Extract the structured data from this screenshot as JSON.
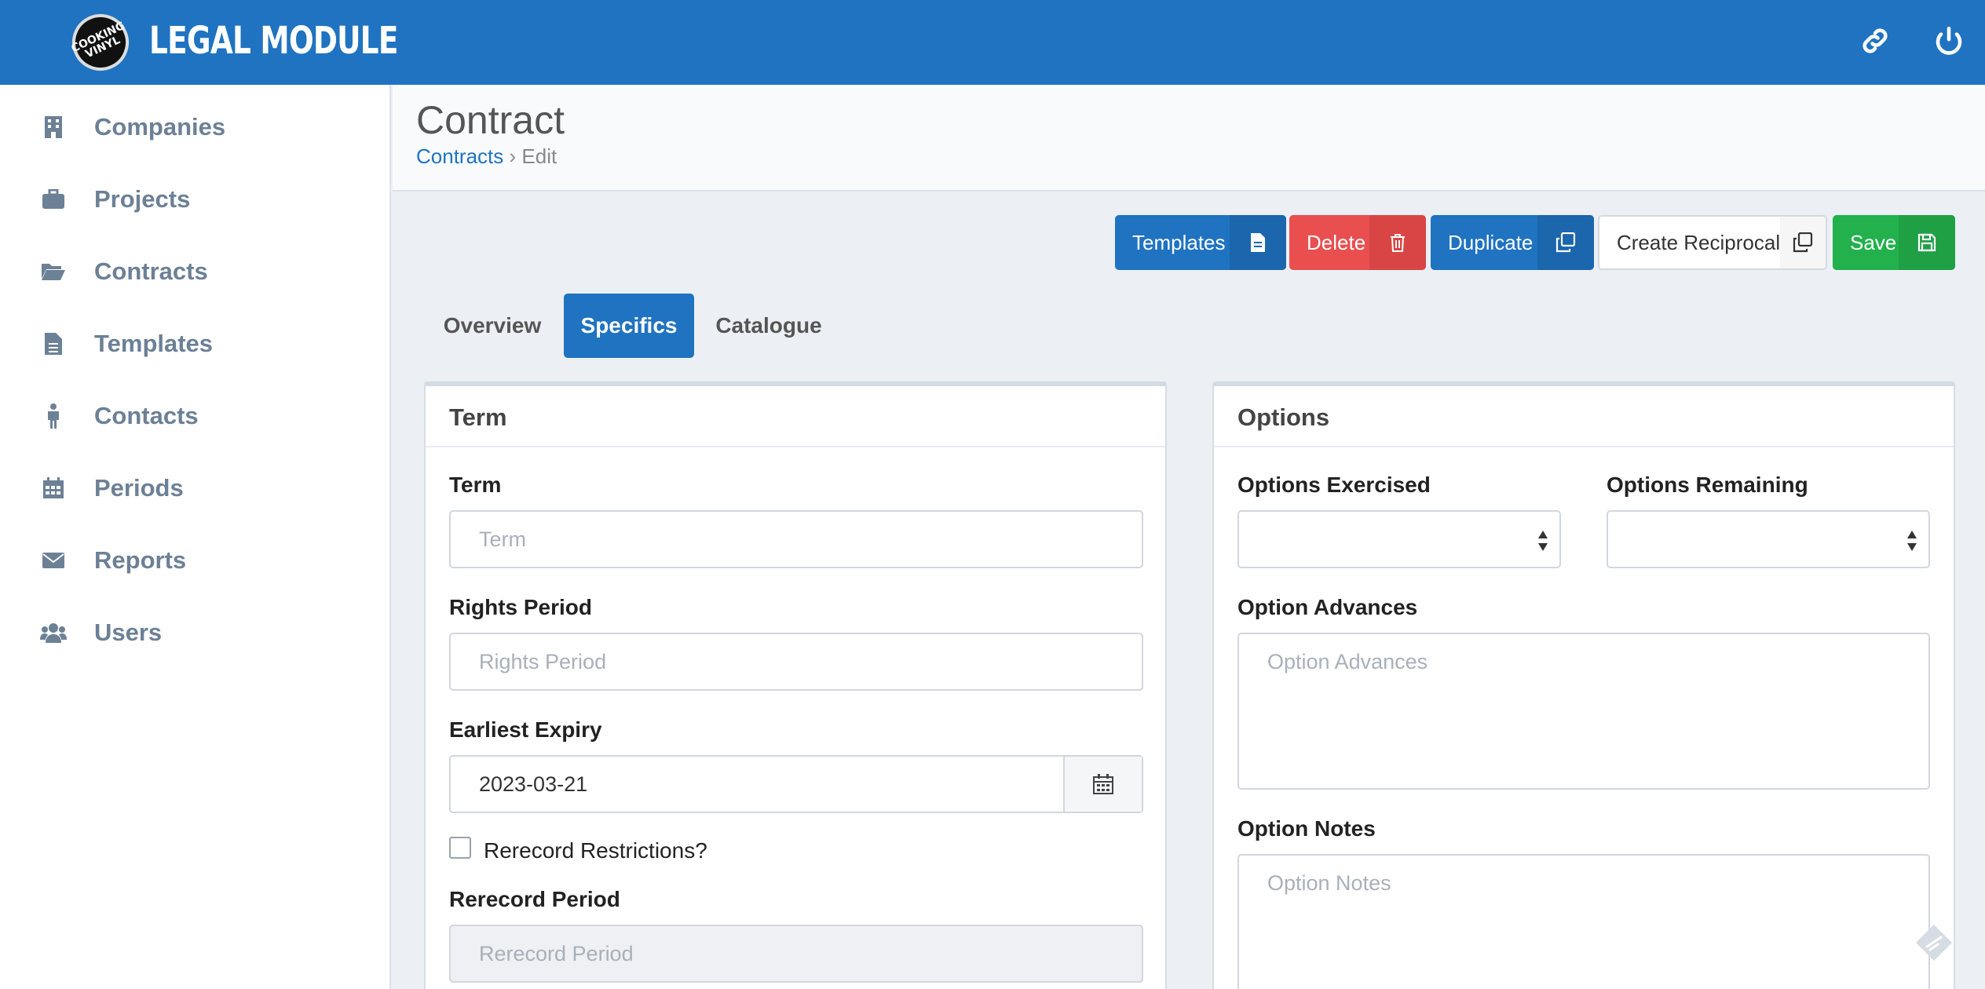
{
  "header": {
    "logo_text": "COOKING VINYL",
    "brand": "LEGAL MODULE",
    "link_icon": "link-icon",
    "power_icon": "power-icon"
  },
  "sidebar": {
    "items": [
      {
        "label": "Companies",
        "icon": "building-icon"
      },
      {
        "label": "Projects",
        "icon": "briefcase-icon"
      },
      {
        "label": "Contracts",
        "icon": "folder-open-icon"
      },
      {
        "label": "Templates",
        "icon": "file-text-icon"
      },
      {
        "label": "Contacts",
        "icon": "person-icon"
      },
      {
        "label": "Periods",
        "icon": "calendar-icon"
      },
      {
        "label": "Reports",
        "icon": "envelope-icon"
      },
      {
        "label": "Users",
        "icon": "users-icon"
      }
    ]
  },
  "page": {
    "title": "Contract",
    "breadcrumb": {
      "link": "Contracts",
      "separator": "›",
      "current": "Edit"
    }
  },
  "actions": {
    "templates": "Templates",
    "delete": "Delete",
    "duplicate": "Duplicate",
    "create_reciprocal": "Create Reciprocal",
    "save": "Save"
  },
  "tabs": {
    "overview": "Overview",
    "specifics": "Specifics",
    "catalogue": "Catalogue",
    "active": "Specifics"
  },
  "term_panel": {
    "title": "Term",
    "term": {
      "label": "Term",
      "value": "",
      "placeholder": "Term"
    },
    "rights_period": {
      "label": "Rights Period",
      "value": "",
      "placeholder": "Rights Period"
    },
    "earliest_expiry": {
      "label": "Earliest Expiry",
      "value": "2023-03-21"
    },
    "rerecord_restrictions": {
      "label": "Rerecord Restrictions?",
      "checked": false
    },
    "rerecord_period": {
      "label": "Rerecord Period",
      "value": "",
      "placeholder": "Rerecord Period",
      "disabled": true
    }
  },
  "options_panel": {
    "title": "Options",
    "options_exercised": {
      "label": "Options Exercised",
      "value": ""
    },
    "options_remaining": {
      "label": "Options Remaining",
      "value": ""
    },
    "option_advances": {
      "label": "Option Advances",
      "value": "",
      "placeholder": "Option Advances"
    },
    "option_notes": {
      "label": "Option Notes",
      "value": "",
      "placeholder": "Option Notes"
    }
  },
  "colors": {
    "primary": "#1f73c1",
    "danger": "#e94f4f",
    "success": "#22b14c",
    "sidebar_text": "#6c8096",
    "background": "#ecf0f5"
  }
}
